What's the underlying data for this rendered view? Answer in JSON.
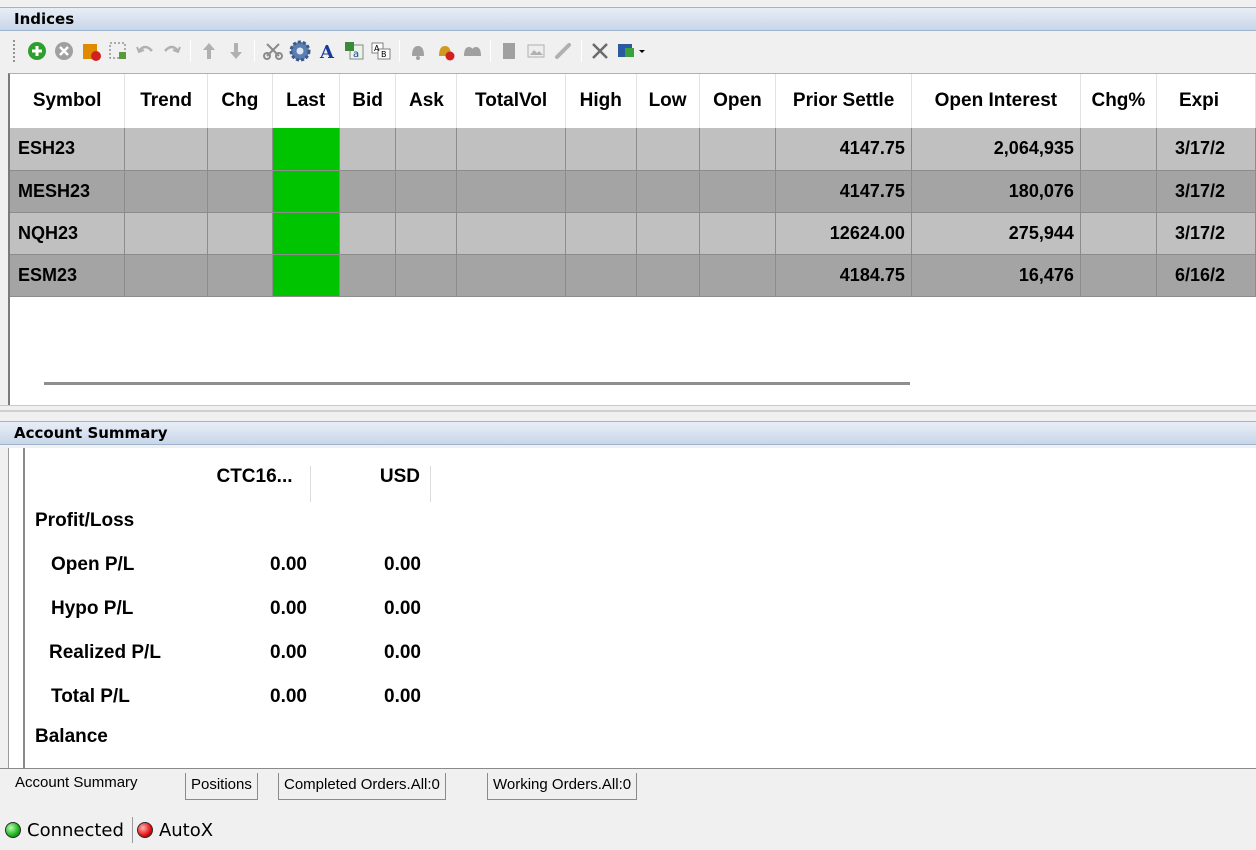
{
  "indices": {
    "title": "Indices",
    "toolbar": [
      {
        "icon": "add-icon",
        "color": "#2e9e2e"
      },
      {
        "icon": "remove-icon",
        "color": "#a0a0a0"
      },
      {
        "icon": "new-sheet-icon",
        "color": "#e08a00"
      },
      {
        "icon": "select-area-icon",
        "color": "#5a9a3a"
      },
      {
        "icon": "undo-icon",
        "color": "#b0b0b0"
      },
      {
        "icon": "redo-icon",
        "color": "#b0b0b0"
      },
      {
        "icon": "move-up-icon",
        "color": "#b0b0b0"
      },
      {
        "icon": "move-down-icon",
        "color": "#b0b0b0"
      },
      {
        "icon": "cut-icon",
        "color": "#8a8a8a"
      },
      {
        "icon": "settings-gear-icon",
        "color": "#5a7fb0"
      },
      {
        "icon": "font-icon",
        "color": "#1a3a9a"
      },
      {
        "icon": "export-excel-icon",
        "color": "#3a8a3a"
      },
      {
        "icon": "rename-icon",
        "color": "#808080"
      },
      {
        "icon": "alert-bell-icon",
        "color": "#a0a0a0"
      },
      {
        "icon": "alert-delete-icon",
        "color": "#d09a20"
      },
      {
        "icon": "alert-group-icon",
        "color": "#a0a0a0"
      },
      {
        "icon": "chart-doc-icon",
        "color": "#a0a0a0"
      },
      {
        "icon": "image-icon",
        "color": "#b0b0b0"
      },
      {
        "icon": "link-icon",
        "color": "#b0b0b0"
      },
      {
        "icon": "tools-icon",
        "color": "#6a6a6a"
      },
      {
        "icon": "workspace-dropdown-icon",
        "color": "#2a5aa0"
      }
    ],
    "columns": [
      "Symbol",
      "Trend",
      "Chg",
      "Last",
      "Bid",
      "Ask",
      "TotalVol",
      "High",
      "Low",
      "Open",
      "Prior Settle",
      "Open Interest",
      "Chg%",
      "Expi"
    ],
    "rows": [
      {
        "symbol": "ESH23",
        "prior_settle": "4147.75",
        "open_interest": "2,064,935",
        "expiry": "3/17/2"
      },
      {
        "symbol": "MESH23",
        "prior_settle": "4147.75",
        "open_interest": "180,076",
        "expiry": "3/17/2"
      },
      {
        "symbol": "NQH23",
        "prior_settle": "12624.00",
        "open_interest": "275,944",
        "expiry": "3/17/2"
      },
      {
        "symbol": "ESM23",
        "prior_settle": "4184.75",
        "open_interest": "16,476",
        "expiry": "6/16/2"
      }
    ],
    "last_cell_color": "#00c400"
  },
  "account_summary": {
    "title": "Account Summary",
    "columns": [
      "CTC16...",
      "USD"
    ],
    "sections": [
      {
        "label": "Profit/Loss"
      },
      {
        "label": "Open P/L",
        "values": [
          "0.00",
          "0.00"
        ]
      },
      {
        "label": "Hypo P/L",
        "values": [
          "0.00",
          "0.00"
        ]
      },
      {
        "label": "Realized P/L",
        "values": [
          "0.00",
          "0.00"
        ]
      },
      {
        "label": "Total P/L",
        "values": [
          "0.00",
          "0.00"
        ]
      },
      {
        "label": "Balance"
      }
    ]
  },
  "tabs": [
    "Account Summary",
    "Positions",
    "Completed Orders.All:0",
    "Working Orders.All:0"
  ],
  "status": {
    "connected": "Connected",
    "autox": "AutoX"
  }
}
